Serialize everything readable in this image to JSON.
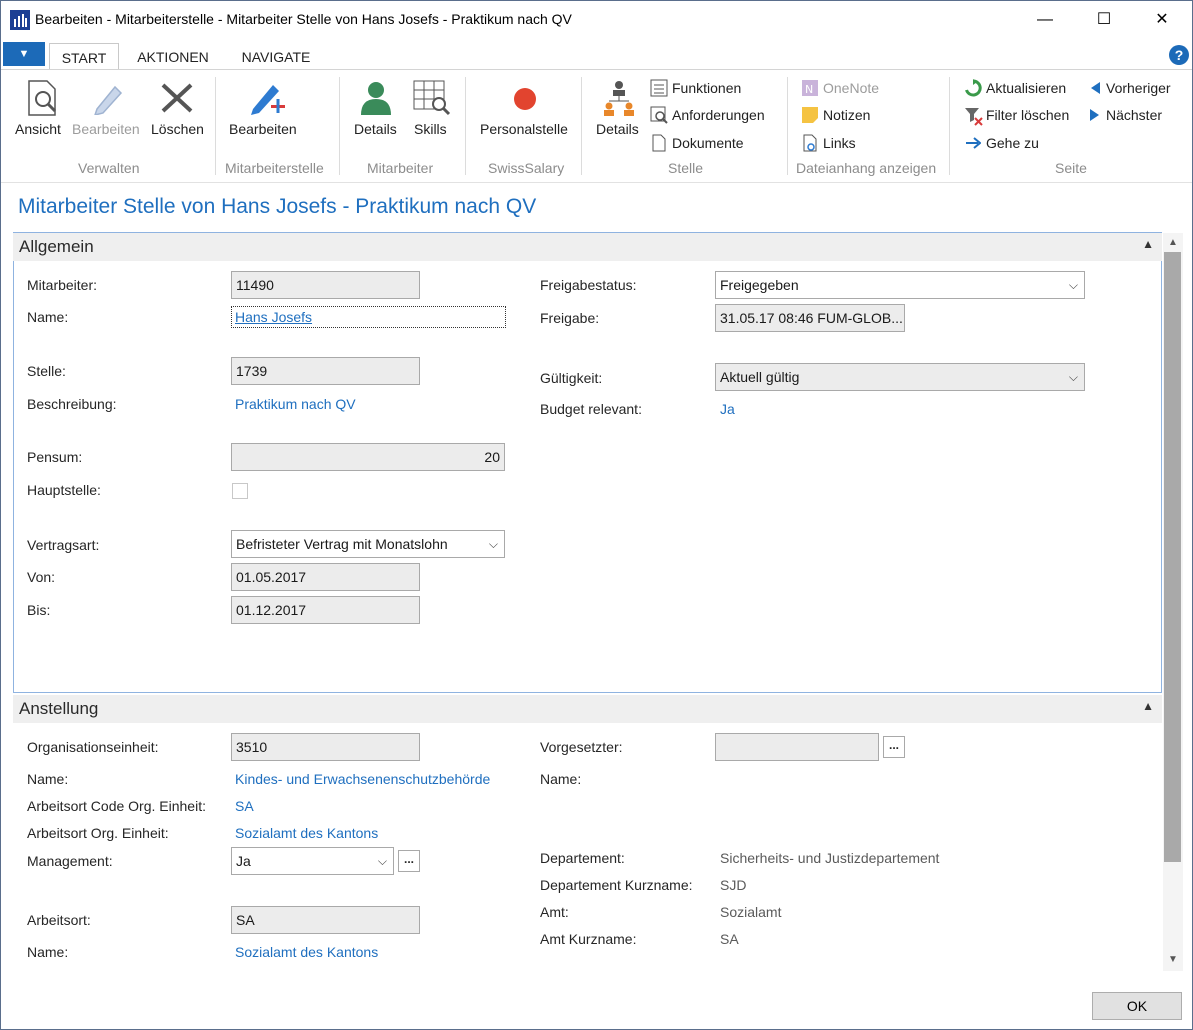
{
  "window": {
    "title": "Bearbeiten - Mitarbeiterstelle - Mitarbeiter Stelle von Hans Josefs - Praktikum nach QV",
    "minimize": "—",
    "maximize": "☐",
    "close": "✕"
  },
  "tabs": [
    "START",
    "AKTIONEN",
    "NAVIGATE"
  ],
  "ribbon": {
    "verwalten": {
      "label": "Verwalten",
      "ansicht": "Ansicht",
      "bearbeiten": "Bearbeiten",
      "loeschen": "Löschen"
    },
    "mitarbeiterstelle": {
      "label": "Mitarbeiterstelle",
      "bearbeiten": "Bearbeiten"
    },
    "mitarbeiter": {
      "label": "Mitarbeiter",
      "details": "Details",
      "skills": "Skills"
    },
    "swisssalary": {
      "label": "SwissSalary",
      "personalstelle": "Personalstelle"
    },
    "stelle": {
      "label": "Stelle",
      "details": "Details",
      "funktionen": "Funktionen",
      "anforderungen": "Anforderungen",
      "dokumente": "Dokumente"
    },
    "dateianhang": {
      "label": "Dateianhang anzeigen",
      "onenote": "OneNote",
      "notizen": "Notizen",
      "links": "Links"
    },
    "seite": {
      "label": "Seite",
      "aktualisieren": "Aktualisieren",
      "filter_loeschen": "Filter löschen",
      "gehe_zu": "Gehe zu",
      "vorheriger": "Vorheriger",
      "naechster": "Nächster"
    }
  },
  "page_title": "Mitarbeiter Stelle von Hans Josefs - Praktikum nach QV",
  "allgemein": {
    "header": "Allgemein",
    "mitarbeiter_label": "Mitarbeiter:",
    "mitarbeiter_value": "11490",
    "name_label": "Name:",
    "name_value": "Hans Josefs",
    "stelle_label": "Stelle:",
    "stelle_value": "1739",
    "beschreibung_label": "Beschreibung:",
    "beschreibung_value": "Praktikum nach QV",
    "pensum_label": "Pensum:",
    "pensum_value": "20",
    "hauptstelle_label": "Hauptstelle:",
    "vertragsart_label": "Vertragsart:",
    "vertragsart_value": "Befristeter Vertrag mit Monatslohn",
    "von_label": "Von:",
    "von_value": "01.05.2017",
    "bis_label": "Bis:",
    "bis_value": "01.12.2017",
    "freigabestatus_label": "Freigabestatus:",
    "freigabestatus_value": "Freigegeben",
    "freigabe_label": "Freigabe:",
    "freigabe_value": "31.05.17 08:46 FUM-GLOB...",
    "gueltigkeit_label": "Gültigkeit:",
    "gueltigkeit_value": "Aktuell gültig",
    "budget_label": "Budget relevant:",
    "budget_value": "Ja"
  },
  "anstellung": {
    "header": "Anstellung",
    "orgeinheit_label": "Organisationseinheit:",
    "orgeinheit_value": "3510",
    "name_label": "Name:",
    "name_value": "Kindes- und Erwachsenenschutzbehörde",
    "arbeitsort_code_label": "Arbeitsort Code Org. Einheit:",
    "arbeitsort_code_value": "SA",
    "arbeitsort_org_label": "Arbeitsort Org. Einheit:",
    "arbeitsort_org_value": "Sozialamt des Kantons",
    "management_label": "Management:",
    "management_value": "Ja",
    "arbeitsort_label": "Arbeitsort:",
    "arbeitsort_value": "SA",
    "name2_label": "Name:",
    "name2_value": "Sozialamt des Kantons",
    "vorgesetzter_label": "Vorgesetzter:",
    "vorgesetzter_value": "",
    "vname_label": "Name:",
    "departement_label": "Departement:",
    "departement_value": "Sicherheits- und Justizdepartement",
    "dep_kurz_label": "Departement Kurzname:",
    "dep_kurz_value": "SJD",
    "amt_label": "Amt:",
    "amt_value": "Sozialamt",
    "amt_kurz_label": "Amt Kurzname:",
    "amt_kurz_value": "SA"
  },
  "ok_button": "OK",
  "colors": {
    "accent": "#1f6fbf",
    "section_bg": "#efefef",
    "field_bg": "#ececec"
  }
}
